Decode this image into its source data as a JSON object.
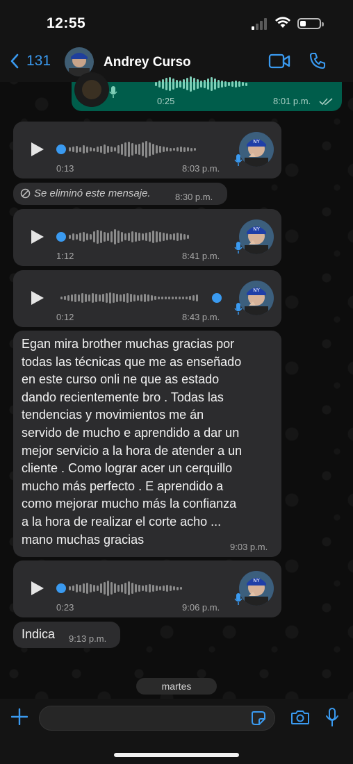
{
  "status": {
    "time": "12:55"
  },
  "header": {
    "back_count": "131",
    "contact_name": "Andrey Curso"
  },
  "messages": [
    {
      "type": "voice",
      "direction": "out",
      "duration": "0:25",
      "time": "8:01 p.m."
    },
    {
      "type": "voice",
      "direction": "in",
      "duration": "0:13",
      "time": "8:03 p.m."
    },
    {
      "type": "deleted",
      "direction": "in",
      "text": "Se eliminó este mensaje.",
      "time": "8:30 p.m."
    },
    {
      "type": "voice",
      "direction": "in",
      "duration": "1:12",
      "time": "8:41 p.m."
    },
    {
      "type": "voice",
      "direction": "in",
      "duration": "0:12",
      "time": "8:43 p.m."
    },
    {
      "type": "text",
      "direction": "in",
      "text": "Egan  mira brother muchas gracias por\ntodas las técnicas  que me as enseñado\nen este curso onli  ne que as estado\ndando recientemente  bro  . Todas las\ntendencias  y movimientos  me  án\nservido  de mucho  e aprendido a dar un\nmejor servicio a la hora de atender a un\ncliente . Como lograr acer un cerquillo\nmucho más perfecto  .  E aprendido  a\ncomo mejorar mucho más la confianza\na la hora de realizar el corte  acho ...\nmano muchas gracias",
      "time": "9:03 p.m."
    },
    {
      "type": "voice",
      "direction": "in",
      "duration": "0:23",
      "time": "9:06 p.m."
    },
    {
      "type": "text",
      "direction": "in",
      "text": "Indica",
      "time": "9:13 p.m."
    }
  ],
  "date_separator": "martes",
  "input": {
    "placeholder": "",
    "value": ""
  },
  "colors": {
    "accent": "#3a9af0",
    "bubble_in": "#2c2c2e",
    "bubble_out": "#005d4b",
    "background": "#0d0d0d"
  },
  "icons": [
    "back-chevron-icon",
    "video-camera-icon",
    "phone-icon",
    "play-icon",
    "microphone-icon",
    "blocked-icon",
    "double-check-icon",
    "plus-icon",
    "sticker-icon",
    "camera-icon"
  ]
}
